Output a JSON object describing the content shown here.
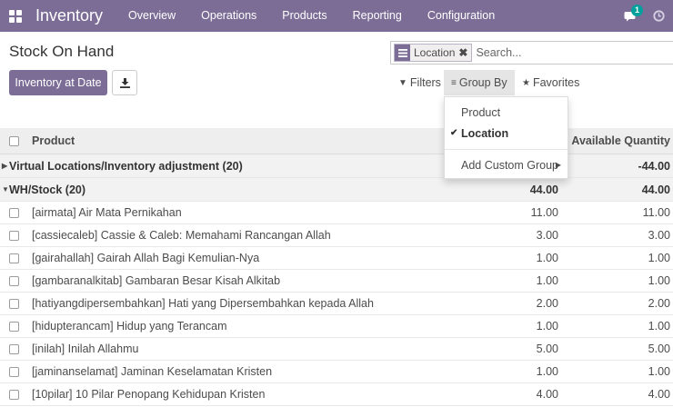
{
  "navbar": {
    "app_name": "Inventory",
    "menu": [
      "Overview",
      "Operations",
      "Products",
      "Reporting",
      "Configuration"
    ],
    "messages_count": "1",
    "bg_color": "#7c6d97"
  },
  "page": {
    "title": "Stock On Hand",
    "primary_button": "Inventory at Date"
  },
  "search": {
    "facet_label": "Location",
    "facet_close": "✖",
    "placeholder": "Search...",
    "filters_label": "Filters",
    "groupby_label": "Group By",
    "favorites_label": "Favorites"
  },
  "groupby_menu": {
    "items": [
      "Product",
      "Location"
    ],
    "selected": "Location",
    "custom_label": "Add Custom Group"
  },
  "table": {
    "columns": [
      "Product",
      "Available Quantity"
    ],
    "groups": [
      {
        "label": "Virtual Locations/Inventory adjustment (20)",
        "col1": "",
        "col2": "-44.00",
        "expanded": false
      },
      {
        "label": "WH/Stock (20)",
        "col1": "44.00",
        "col2": "44.00",
        "expanded": true
      }
    ],
    "rows": [
      {
        "product": "[airmata] Air Mata Pernikahan",
        "qty": "11.00",
        "available": "11.00"
      },
      {
        "product": "[cassiecaleb] Cassie & Caleb: Memahami Rancangan Allah",
        "qty": "3.00",
        "available": "3.00"
      },
      {
        "product": "[gairahallah] Gairah Allah Bagi Kemulian-Nya",
        "qty": "1.00",
        "available": "1.00"
      },
      {
        "product": "[gambaranalkitab] Gambaran Besar Kisah Alkitab",
        "qty": "1.00",
        "available": "1.00"
      },
      {
        "product": "[hatiyangdipersembahkan] Hati yang Dipersembahkan kepada Allah",
        "qty": "2.00",
        "available": "2.00"
      },
      {
        "product": "[hidupterancam] Hidup yang Terancam",
        "qty": "1.00",
        "available": "1.00"
      },
      {
        "product": "[inilah] Inilah Allahmu",
        "qty": "5.00",
        "available": "5.00"
      },
      {
        "product": "[jaminanselamat] Jaminan Keselamatan Kristen",
        "qty": "1.00",
        "available": "1.00"
      },
      {
        "product": "[10pilar] 10 Pilar Penopang Kehidupan Kristen",
        "qty": "4.00",
        "available": "4.00"
      }
    ]
  }
}
